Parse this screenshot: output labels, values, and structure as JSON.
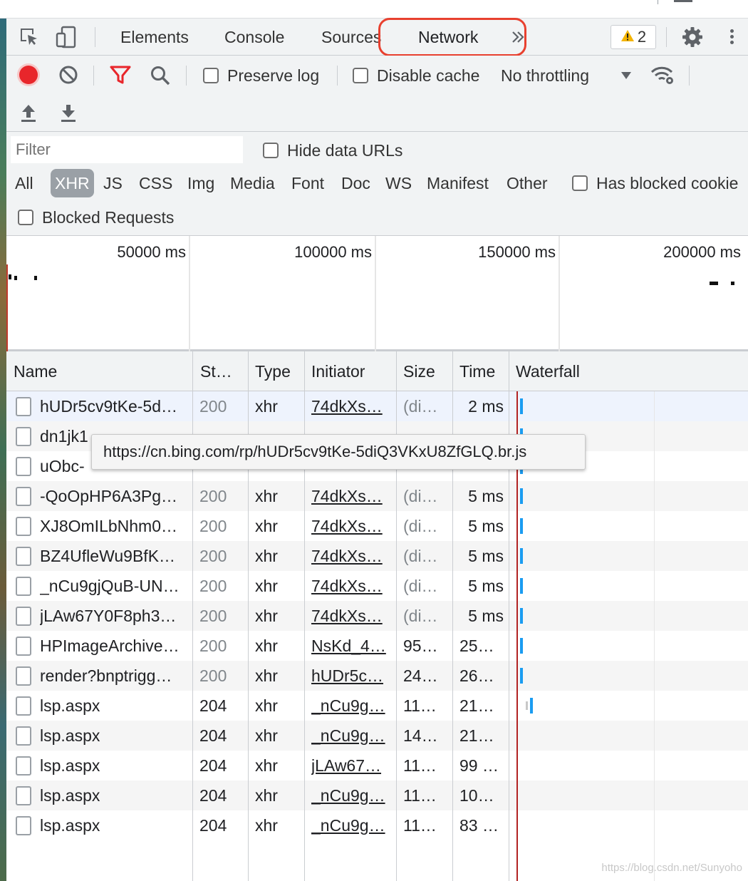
{
  "tabs": [
    {
      "label": "Elements"
    },
    {
      "label": "Console"
    },
    {
      "label": "Sources"
    },
    {
      "label": "Network"
    }
  ],
  "warnings": {
    "count": "2"
  },
  "toolbar": {
    "preserve_log": "Preserve log",
    "disable_cache": "Disable cache",
    "throttling": "No throttling"
  },
  "filter": {
    "placeholder": "Filter",
    "hide_data_urls": "Hide data URLs",
    "types": [
      "All",
      "XHR",
      "JS",
      "CSS",
      "Img",
      "Media",
      "Font",
      "Doc",
      "WS",
      "Manifest",
      "Other"
    ],
    "active_type": "XHR",
    "has_blocked_cookies": "Has blocked cookie",
    "blocked_requests": "Blocked Requests"
  },
  "overview": {
    "ticks": [
      "50000 ms",
      "100000 ms",
      "150000 ms",
      "200000 ms"
    ]
  },
  "columns": [
    "Name",
    "St…",
    "Type",
    "Initiator",
    "Size",
    "Time",
    "Waterfall"
  ],
  "rows": [
    {
      "name": "hUDr5cv9tKe-5d…",
      "status": "200",
      "type": "xhr",
      "initiator": "74dkXs…",
      "size": "(di…",
      "time": "2 ms"
    },
    {
      "name": "dn1jk1",
      "status": "",
      "type": "",
      "initiator": "",
      "size": "",
      "time": ""
    },
    {
      "name": "uObc-",
      "status": "",
      "type": "",
      "initiator": "",
      "size": "",
      "time": ""
    },
    {
      "name": "-QoOpHP6A3Pg…",
      "status": "200",
      "type": "xhr",
      "initiator": "74dkXs…",
      "size": "(di…",
      "time": "5 ms"
    },
    {
      "name": "XJ8OmILbNhm0…",
      "status": "200",
      "type": "xhr",
      "initiator": "74dkXs…",
      "size": "(di…",
      "time": "5 ms"
    },
    {
      "name": "BZ4UfleWu9BfK…",
      "status": "200",
      "type": "xhr",
      "initiator": "74dkXs…",
      "size": "(di…",
      "time": "5 ms"
    },
    {
      "name": "_nCu9gjQuB-UN…",
      "status": "200",
      "type": "xhr",
      "initiator": "74dkXs…",
      "size": "(di…",
      "time": "5 ms"
    },
    {
      "name": "jLAw67Y0F8ph3…",
      "status": "200",
      "type": "xhr",
      "initiator": "74dkXs…",
      "size": "(di…",
      "time": "5 ms"
    },
    {
      "name": "HPImageArchive…",
      "status": "200",
      "type": "xhr",
      "initiator": "NsKd_4…",
      "size": "95…",
      "time": "25…"
    },
    {
      "name": "render?bnptrigg…",
      "status": "200",
      "type": "xhr",
      "initiator": "hUDr5c…",
      "size": "24…",
      "time": "26…"
    },
    {
      "name": "lsp.aspx",
      "status": "204",
      "type": "xhr",
      "initiator": "_nCu9g…",
      "size": "11…",
      "time": "21…"
    },
    {
      "name": "lsp.aspx",
      "status": "204",
      "type": "xhr",
      "initiator": "_nCu9g…",
      "size": "14…",
      "time": "21…"
    },
    {
      "name": "lsp.aspx",
      "status": "204",
      "type": "xhr",
      "initiator": "jLAw67…",
      "size": "11…",
      "time": "99 …"
    },
    {
      "name": "lsp.aspx",
      "status": "204",
      "type": "xhr",
      "initiator": "_nCu9g…",
      "size": "11…",
      "time": "10…"
    },
    {
      "name": "lsp.aspx",
      "status": "204",
      "type": "xhr",
      "initiator": "_nCu9g…",
      "size": "11…",
      "time": "83 …"
    }
  ],
  "tooltip": "https://cn.bing.com/rp/hUDr5cv9tKe-5diQ3VKxU8ZfGLQ.br.js",
  "watermark": "https://blog.csdn.net/Sunyoho",
  "colors": {
    "record": "#e8262b",
    "filter_active": "#e8262b",
    "annotation": "#e8402f",
    "waterfall_bar": "#1a9cf1"
  },
  "icons": [
    "inspect-element-icon",
    "device-toolbar-icon",
    "more-tabs-chevron-icon",
    "warning-icon",
    "settings-gear-icon",
    "kebab-menu-icon",
    "record-icon",
    "clear-icon",
    "filter-icon",
    "search-icon",
    "network-conditions-icon",
    "import-har-icon",
    "export-har-icon",
    "file-icon"
  ]
}
